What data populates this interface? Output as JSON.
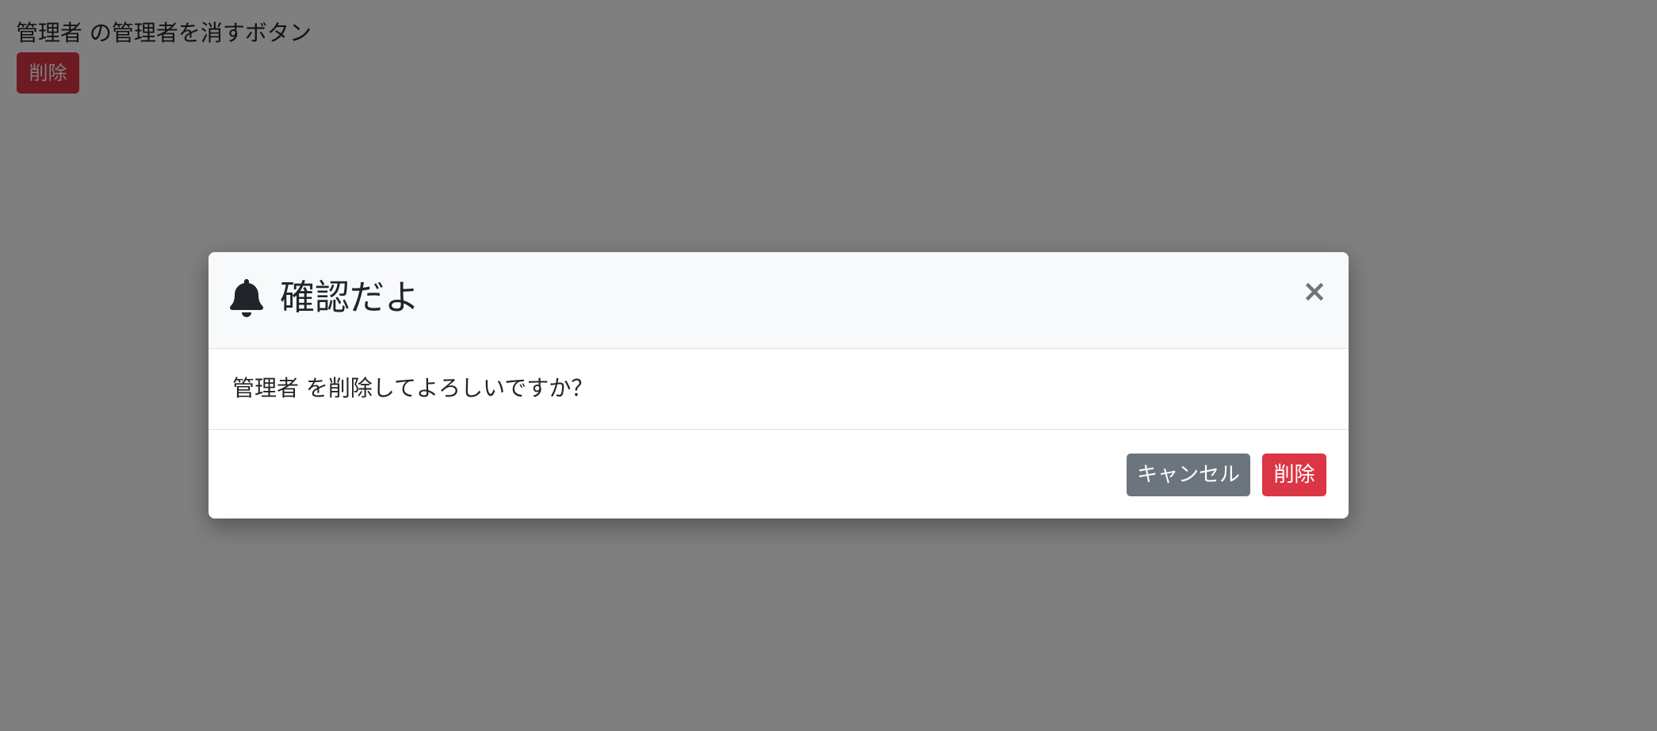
{
  "page": {
    "heading": "管理者 の管理者を消すボタン",
    "delete_button_label": "削除"
  },
  "modal": {
    "title": "確認だよ",
    "title_icon": "bell-icon",
    "close_symbol": "×",
    "message": "管理者 を削除してよろしいですか？",
    "cancel_label": "キャンセル",
    "delete_label": "削除"
  },
  "colors": {
    "danger": "#dc3545",
    "secondary": "#6c757d",
    "backdrop": "rgba(0,0,0,0.5)",
    "header_bg": "#f8f9fa"
  }
}
